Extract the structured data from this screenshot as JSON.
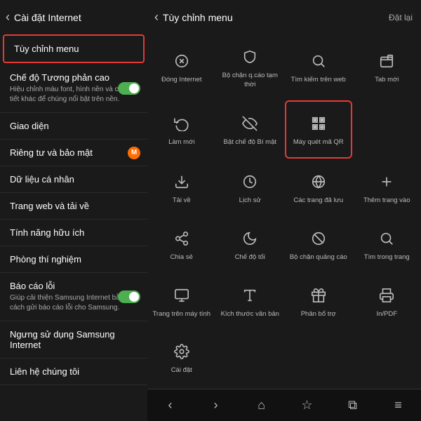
{
  "left": {
    "header": {
      "back": "‹",
      "title": "Cài đặt Internet"
    },
    "items": [
      {
        "id": "tuy-chinh-menu",
        "label": "Tùy chỉnh menu",
        "sub": "",
        "highlighted": true,
        "toggle": false,
        "badge": false
      },
      {
        "id": "che-do-tuong-phan",
        "label": "Chế độ Tương phản cao",
        "sub": "Hiệu chỉnh màu font, hình nền và các chi tiết khác để chúng nổi bật trên nền.",
        "highlighted": false,
        "toggle": true,
        "badge": false
      },
      {
        "id": "giao-dien",
        "label": "Giao diện",
        "sub": "",
        "highlighted": false,
        "toggle": false,
        "badge": false
      },
      {
        "id": "rieng-tu-bao-mat",
        "label": "Riêng tư và bảo mật",
        "sub": "",
        "highlighted": false,
        "toggle": false,
        "badge": true
      },
      {
        "id": "du-lieu-ca-nhan",
        "label": "Dữ liệu cá nhân",
        "sub": "",
        "highlighted": false,
        "toggle": false,
        "badge": false
      },
      {
        "id": "trang-web-tai-ve",
        "label": "Trang web và tải về",
        "sub": "",
        "highlighted": false,
        "toggle": false,
        "badge": false
      },
      {
        "id": "tinh-nang-huu-ich",
        "label": "Tính năng hữu ích",
        "sub": "",
        "highlighted": false,
        "toggle": false,
        "badge": false
      },
      {
        "id": "phong-thi-nghiem",
        "label": "Phòng thí nghiệm",
        "sub": "",
        "highlighted": false,
        "toggle": false,
        "badge": false
      },
      {
        "id": "bao-cao-loi",
        "label": "Báo cáo lỗi",
        "sub": "Giúp cải thiện Samsung Internet bằng cách gửi báo cáo lỗi cho Samsung.",
        "highlighted": false,
        "toggle": true,
        "badge": false
      },
      {
        "id": "ngung-su-dung",
        "label": "Ngưng sử dụng Samsung Internet",
        "sub": "",
        "highlighted": false,
        "toggle": false,
        "badge": false
      },
      {
        "id": "lien-he",
        "label": "Liên hệ chúng tôi",
        "sub": "",
        "highlighted": false,
        "toggle": false,
        "badge": false
      }
    ]
  },
  "right": {
    "header": {
      "back": "‹",
      "title": "Tùy chỉnh menu",
      "reset": "Đặt lại"
    },
    "grid": [
      {
        "id": "dong-internet",
        "icon": "close-circle",
        "label": "Đóng Internet",
        "selected": false,
        "unicode": "⊗"
      },
      {
        "id": "bo-chan-quang-cao-tam",
        "icon": "shield",
        "label": "Bộ chặn q.cáo tạm thời",
        "selected": false,
        "unicode": "🛡"
      },
      {
        "id": "tim-kiem-web",
        "icon": "search",
        "label": "Tìm kiếm trên web",
        "selected": false,
        "unicode": "🔍"
      },
      {
        "id": "tab-moi",
        "icon": "tab",
        "label": "Tab mới",
        "selected": false,
        "unicode": "⊞"
      },
      {
        "id": "lam-moi",
        "icon": "refresh",
        "label": "Làm mới",
        "selected": false,
        "unicode": "↻"
      },
      {
        "id": "bat-che-do-bi-mat",
        "icon": "eye-off",
        "label": "Bật chế độ Bí mật",
        "selected": false,
        "unicode": "👁"
      },
      {
        "id": "may-quet-ma-qr",
        "icon": "qr",
        "label": "Máy quét mã QR",
        "selected": true,
        "unicode": "▦"
      },
      {
        "id": "placeholder1",
        "icon": "",
        "label": "",
        "selected": false,
        "unicode": ""
      },
      {
        "id": "tai-ve",
        "icon": "download",
        "label": "Tải về",
        "selected": false,
        "unicode": "⬇"
      },
      {
        "id": "lich-su",
        "icon": "clock",
        "label": "Lịch sử",
        "selected": false,
        "unicode": "🕐"
      },
      {
        "id": "cac-trang-da-luu",
        "icon": "bookmark",
        "label": "Các trang đã lưu",
        "selected": false,
        "unicode": "🌐"
      },
      {
        "id": "them-trang-vao",
        "icon": "plus",
        "label": "Thêm trang vào",
        "selected": false,
        "unicode": "+"
      },
      {
        "id": "chia-se",
        "icon": "share",
        "label": "Chia sẻ",
        "selected": false,
        "unicode": "◁"
      },
      {
        "id": "che-do-toi",
        "icon": "moon",
        "label": "Chế độ tối",
        "selected": false,
        "unicode": "🌙"
      },
      {
        "id": "bo-chan-quang-cao",
        "icon": "block",
        "label": "Bộ chặn quảng cáo",
        "selected": false,
        "unicode": "⊘"
      },
      {
        "id": "tim-trong-trang",
        "icon": "find",
        "label": "Tìm trong trang",
        "selected": false,
        "unicode": "🔎"
      },
      {
        "id": "trang-tren-may-tinh",
        "icon": "monitor",
        "label": "Trang trên máy tính",
        "selected": false,
        "unicode": "🖥"
      },
      {
        "id": "kich-thuoc-van-ban",
        "icon": "text-size",
        "label": "Kích thước văn bản",
        "selected": false,
        "unicode": "T↕"
      },
      {
        "id": "phan-bo-tro",
        "icon": "gift",
        "label": "Phân bổ trợ",
        "selected": false,
        "unicode": "📦"
      },
      {
        "id": "in-pdf",
        "icon": "print",
        "label": "In/PDF",
        "selected": false,
        "unicode": "🖨"
      },
      {
        "id": "cai-dat",
        "icon": "settings",
        "label": "Cài đặt",
        "selected": false,
        "unicode": "⚙"
      },
      {
        "id": "empty1",
        "icon": "",
        "label": "",
        "selected": false,
        "unicode": ""
      },
      {
        "id": "empty2",
        "icon": "",
        "label": "",
        "selected": false,
        "unicode": ""
      },
      {
        "id": "empty3",
        "icon": "",
        "label": "",
        "selected": false,
        "unicode": ""
      }
    ],
    "nav": [
      "‹",
      "›",
      "⌂",
      "☆",
      "⧉",
      "≡"
    ]
  }
}
